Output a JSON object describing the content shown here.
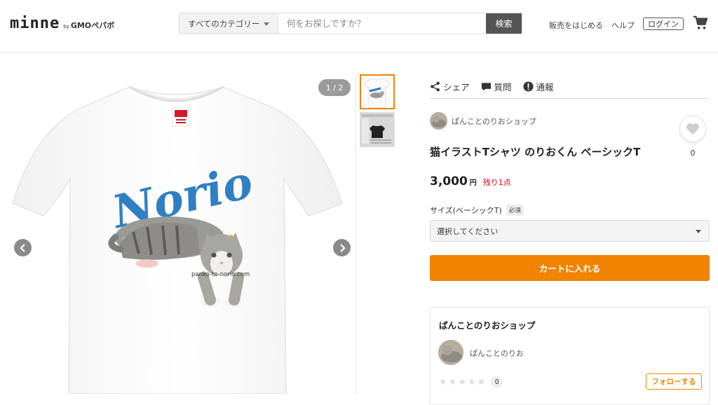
{
  "header": {
    "logo_main": "minne",
    "logo_by": "by",
    "logo_brand": "GMOペパボ",
    "search": {
      "category": "すべてのカテゴリー",
      "placeholder": "何をお探しですか？",
      "button": "検索"
    },
    "nav": {
      "sell": "販売をはじめる",
      "help": "ヘルプ",
      "login": "ログイン"
    },
    "icons": {
      "cart": "cart-icon"
    }
  },
  "gallery": {
    "page_indicator": "1 / 2",
    "shirt_text": "Norio",
    "shirt_caption": "panko-to-norio.com",
    "colors": {
      "blue_text": "#2f7fc4",
      "crown": "#f2b705"
    }
  },
  "actions": {
    "share": "シェア",
    "question": "質問",
    "report": "通報"
  },
  "product": {
    "shop_name": "ぱんことのりおショップ",
    "title": "猫イラストTシャツ のりおくん ベーシックT",
    "price": "3,000",
    "currency": "円",
    "stock": "残り1点",
    "favorites": "0",
    "size_label": "サイズ(ベーシックT)",
    "required": "必須",
    "select_placeholder": "選択してください",
    "cart_button": "カートに入れる"
  },
  "shop_card": {
    "title": "ぱんことのりおショップ",
    "owner": "ぱんことのりお",
    "rating_count": "0",
    "follow": "フォローする"
  },
  "colors": {
    "accent": "#f08300",
    "stock_red": "#e0001b"
  }
}
